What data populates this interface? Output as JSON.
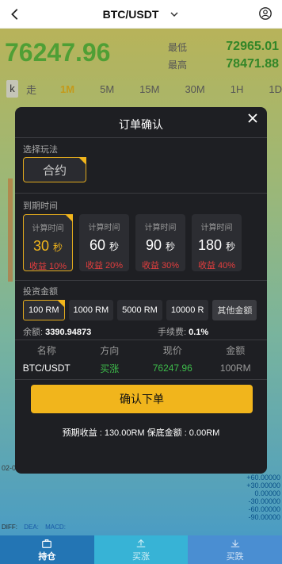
{
  "header": {
    "title": "BTC/USDT"
  },
  "market": {
    "price": "76247.96",
    "low_label": "最低",
    "low_value": "72965.01",
    "high_label": "最高",
    "high_value": "78471.88"
  },
  "timeframes": [
    "k",
    "走",
    "1M",
    "5M",
    "15M",
    "30M",
    "1H",
    "1D"
  ],
  "selected_timeframe": "1M",
  "chart_axis": {
    "labels": [
      "+60.00000",
      "+30.00000",
      "0.00000",
      "-30.00000",
      "-60.00000",
      "-90.00000"
    ],
    "x_label": "02-0"
  },
  "macd": {
    "diff": "DIFF:",
    "dea": "DEA:",
    "macd": "MACD:"
  },
  "bottom_nav": {
    "hold": "持仓",
    "buy_up": "买涨",
    "buy_down": "买跌"
  },
  "modal": {
    "title": "订单确认",
    "play_label": "选择玩法",
    "contract": "合约",
    "expire_label": "到期时间",
    "durations": [
      {
        "calc": "计算时间",
        "sec": "30",
        "unit": "秒",
        "profit": "收益 10%"
      },
      {
        "calc": "计算时间",
        "sec": "60",
        "unit": "秒",
        "profit": "收益 20%"
      },
      {
        "calc": "计算时间",
        "sec": "90",
        "unit": "秒",
        "profit": "收益 30%"
      },
      {
        "calc": "计算时间",
        "sec": "180",
        "unit": "秒",
        "profit": "收益 40%"
      }
    ],
    "amount_label": "投资金额",
    "amounts": [
      "100 RM",
      "1000 RM",
      "5000 RM",
      "10000 R"
    ],
    "other_amount": "其他金额",
    "balance_label": "余额:",
    "balance_value": "3390.94873",
    "fee_label": "手续费:",
    "fee_value": "0.1%",
    "table_headers": [
      "名称",
      "方向",
      "现价",
      "金额"
    ],
    "row": {
      "name": "BTC/USDT",
      "direction": "买涨",
      "price": "76247.96",
      "amount": "100RM"
    },
    "confirm": "确认下单",
    "summary": "预期收益 : 130.00RM   保底金额 : 0.00RM"
  },
  "colors": {
    "accent": "#f1b51c",
    "up": "#3dbb4a",
    "down": "#e53e3e"
  }
}
